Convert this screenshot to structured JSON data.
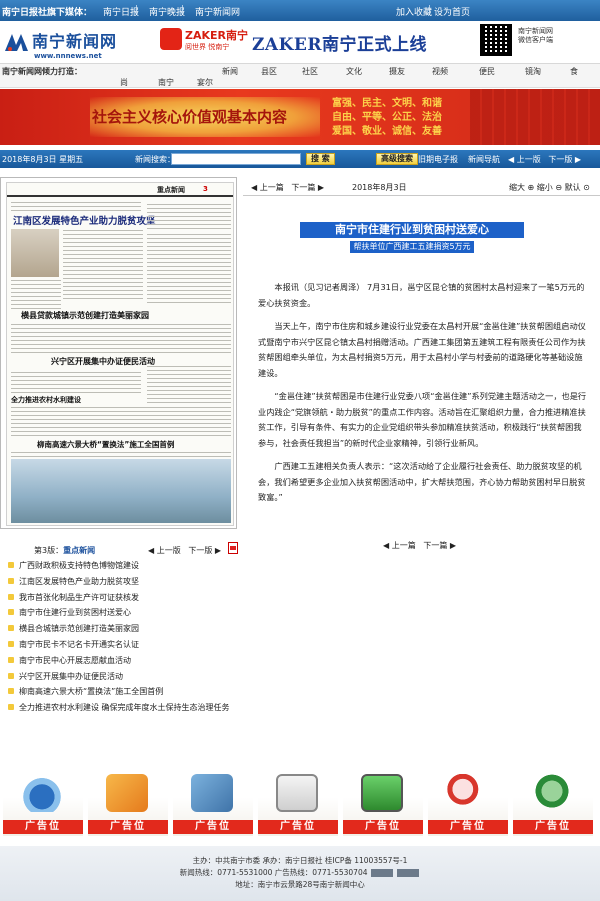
{
  "topbar": {
    "label": "南宁日报社旗下媒体：",
    "links": [
      "南宁日报",
      "南宁晚报",
      "南宁新闻网"
    ],
    "right_links": [
      "加入收藏",
      "设为首页"
    ]
  },
  "header": {
    "logo_text": "南宁新闻网",
    "logo_url": "www.nnnews.net",
    "zaker_name": "ZAKER南宁",
    "zaker_sub": "阅世界 悦南宁",
    "zaker_banner": "ZAKER南宁正式上线",
    "qr_text": [
      "南宁新闻网",
      "微信客户端"
    ]
  },
  "channels": {
    "label": "南宁新闻网倾力打造：",
    "row1": [
      "新闻",
      "县区",
      "社区",
      "文化",
      "摄友",
      "视频",
      "便民",
      "镜淘",
      "食"
    ],
    "row2": [
      "尚",
      "南宁",
      "宴尔"
    ]
  },
  "banner": {
    "title": "社会主义核心价值观基本内容",
    "values": [
      "富强、民主、文明、和谐",
      "自由、平等、公正、法治",
      "爱国、敬业、诚信、友善"
    ]
  },
  "searchbar": {
    "date": "2018年8月3日  星期五",
    "search_label": "新闻搜索：",
    "search_placeholder": "",
    "search_button": "搜 索",
    "advanced_button": "高级搜索",
    "old_paper": "旧期电子报",
    "guide": "新闻导航",
    "prev_page": "上一版",
    "next_page": "下一版"
  },
  "paper": {
    "head_name": "重点新闻",
    "head_num": "3",
    "headline1": "江南区发展特色产业助力脱贫攻坚",
    "headline2": "横县贷款城镇示范创建打造美丽家园",
    "headline3": "兴宁区开展集中办证便民活动",
    "headline4": "全力推进农村水利建设",
    "headline5": "柳南高速六景大桥“置换法”施工全国首例"
  },
  "page_label": {
    "prefix": "第3版：",
    "name": "重点新闻",
    "prev": "上一版",
    "next": "下一版"
  },
  "titles": [
    "广西财政积极支持特色博物馆建设",
    "江南区发展特色产业助力脱贫攻坚",
    "我市首张化制品生产许可证获核发",
    "南宁市住建行业到贫困村送爱心",
    "横县合城镇示范创建打造美丽家园",
    "南宁市民卡不记名卡开通实名认证",
    "南宁市民中心开展志愿献血活动",
    "兴宁区开展集中办证便民活动",
    "柳南高速六景大桥“置换法”施工全国首例",
    "全力推进农村水利建设 确保完成年度水土保持生态治理任务"
  ],
  "article": {
    "prev": "上一篇",
    "next": "下一篇",
    "date": "2018年8月3日",
    "tools": "缩大 ⊕ 缩小 ⊖ 默认 ⊙",
    "title": "南宁市住建行业到贫困村送爱心",
    "subtitle": "帮扶单位广西建工五建捐资5万元",
    "paragraphs": [
      "本报讯（见习记者周泽） 7月31日，邕宁区昆仑镇的贫困村太昌村迎来了一笔5万元的爱心扶贫资金。",
      "当天上午，南宁市住房和城乡建设行业党委在太昌村开展“金邕住建”扶贫帮困组启动仪式暨南宁市兴宁区昆仑镇太昌村捐赠活动。广西建工集团第五建筑工程有限责任公司作为扶贫帮困组牵头单位，为太昌村捐资5万元，用于太昌村小学与村委前的道路硬化等基础设施建设。",
      "“金邕住建”扶贫帮困是市住建行业党委八项“金邕住建”系列党建主题活动之一，也是行业内践企“党旗领航・助力脱贫”的重点工作内容。活动旨在汇聚组织力量，合力推进精准扶贫工作，引导有条件、有实力的企业党组织带头参加精准扶贫活动，积极践行“扶贫帮困我参与，社会责任我担当”的新时代企业家精神，引领行业新风。",
      "广西建工五建相关负责人表示：“这次活动给了企业履行社会责任、助力脱贫攻坚的机会，我们希望更多企业加入扶贫帮困活动中，扩大帮扶范围，齐心协力帮助贫困村早日脱贫致富。”"
    ]
  },
  "ads": {
    "label": "广告位",
    "icons": [
      "phone-icon",
      "email-icon",
      "gallery-icon",
      "clipboard-icon",
      "monitor-icon",
      "search-icon",
      "phone-stand-icon"
    ]
  },
  "footer": {
    "line1": "主办：中共南宁市委  承办：南宁日报社  桂ICP备 11003557号-1",
    "line2": "新闻热线：0771-5531000  广告热线：0771-5530704",
    "line3": "地址：南宁市云景路28号南宁新闻中心"
  },
  "colors": {
    "nav_blue": "#1f5f9e",
    "title_blue": "#1d61c8",
    "banner_red": "#d02917",
    "ad_red": "#e2291c",
    "button_yellow": "#f2cf3e"
  }
}
